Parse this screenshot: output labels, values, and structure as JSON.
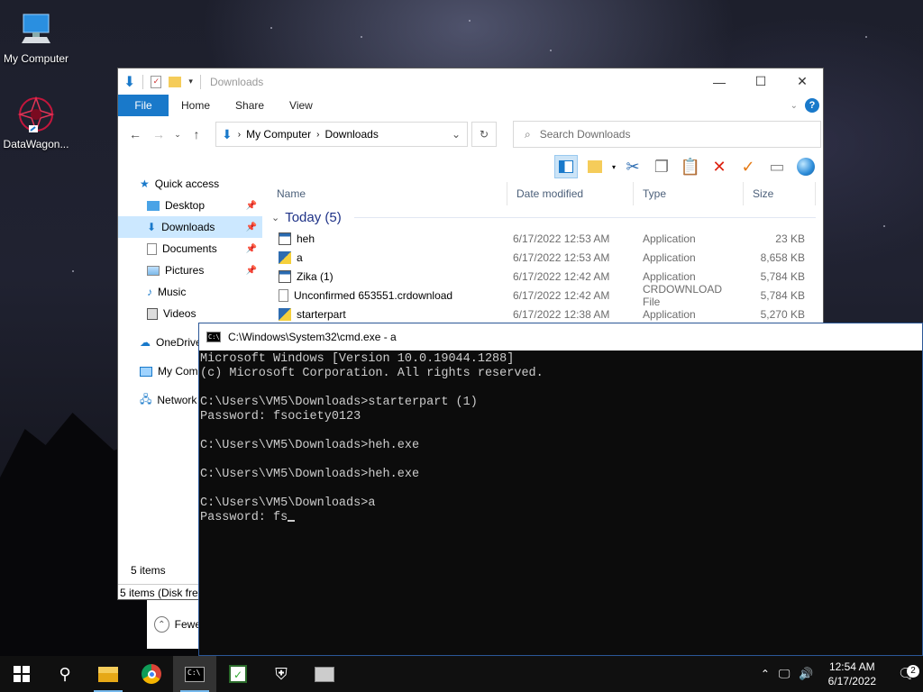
{
  "desktop": {
    "icons": [
      {
        "label": "My Computer"
      },
      {
        "label": "DataWagon..."
      }
    ]
  },
  "explorer": {
    "title": "Downloads",
    "tabs": {
      "file": "File",
      "home": "Home",
      "share": "Share",
      "view": "View"
    },
    "help": "?",
    "breadcrumb": {
      "root": "My Computer",
      "current": "Downloads"
    },
    "search_placeholder": "Search Downloads",
    "columns": {
      "name": "Name",
      "date": "Date modified",
      "type": "Type",
      "size": "Size"
    },
    "group_label": "Today (5)",
    "files": [
      {
        "name": "heh",
        "date": "6/17/2022 12:53 AM",
        "type": "Application",
        "size": "23 KB"
      },
      {
        "name": "a",
        "date": "6/17/2022 12:53 AM",
        "type": "Application",
        "size": "8,658 KB"
      },
      {
        "name": "Zika (1)",
        "date": "6/17/2022 12:42 AM",
        "type": "Application",
        "size": "5,784 KB"
      },
      {
        "name": "Unconfirmed 653551.crdownload",
        "date": "6/17/2022 12:42 AM",
        "type": "CRDOWNLOAD File",
        "size": "5,784 KB"
      },
      {
        "name": "starterpart",
        "date": "6/17/2022 12:38 AM",
        "type": "Application",
        "size": "5,270 KB"
      }
    ],
    "nav": {
      "quick_access": "Quick access",
      "desktop": "Desktop",
      "downloads": "Downloads",
      "documents": "Documents",
      "pictures": "Pictures",
      "music": "Music",
      "videos": "Videos",
      "onedrive": "OneDrive",
      "my_computer": "My Com",
      "network": "Network"
    },
    "status_items": "5 items",
    "status_bar": "5 items (Disk free",
    "fewer_label": "Fewe"
  },
  "cmd": {
    "title": "C:\\Windows\\System32\\cmd.exe - a",
    "lines": [
      "Microsoft Windows [Version 10.0.19044.1288]",
      "(c) Microsoft Corporation. All rights reserved.",
      "",
      "C:\\Users\\VM5\\Downloads>starterpart (1)",
      "Password: fsociety0123",
      "",
      "C:\\Users\\VM5\\Downloads>heh.exe",
      "",
      "C:\\Users\\VM5\\Downloads>heh.exe",
      "",
      "C:\\Users\\VM5\\Downloads>a",
      "Password: fs"
    ]
  },
  "taskbar": {
    "time": "12:54 AM",
    "date": "6/17/2022",
    "notification_count": "2"
  },
  "colors": {
    "accent": "#1979ca",
    "cmd_bg": "#0c0c0c",
    "taskbar_bg": "#101010"
  }
}
